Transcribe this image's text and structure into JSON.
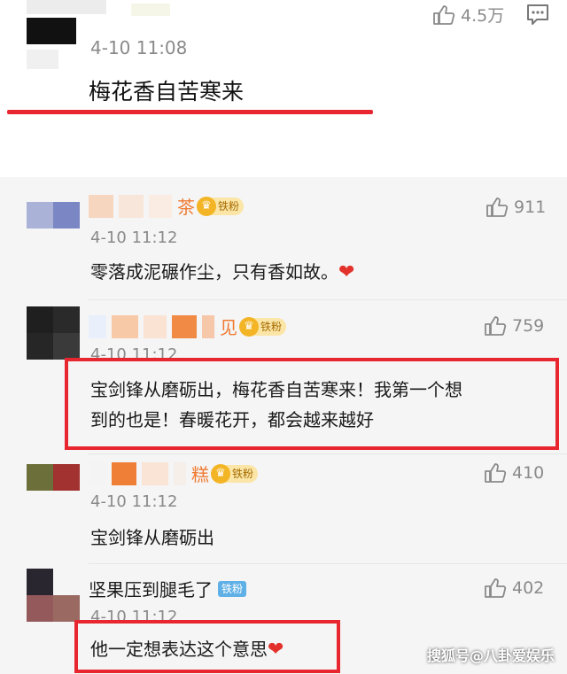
{
  "main_comment": {
    "like_count": "4.5万",
    "time": "4-10 11:08",
    "text": "梅花香自苦寒来"
  },
  "replies": [
    {
      "name_suffix": "茶",
      "badge": "铁粉",
      "like_count": "911",
      "time": "4-10 11:12",
      "text": "零落成泥碾作尘，只有香如故。"
    },
    {
      "name_suffix": "见",
      "badge": "铁粉",
      "like_count": "759",
      "time": "4-10 11:12",
      "text_line1": "宝剑锋从磨砺出，梅花香自苦寒来！我第一个想",
      "text_line2": "到的也是！春暖花开，都会越来越好"
    },
    {
      "name_suffix": "糕",
      "badge": "铁粉",
      "like_count": "410",
      "time": "4-10 11:12",
      "text": "宝剑锋从磨砺出"
    },
    {
      "name": "坚果压到腿毛了",
      "badge": "铁粉",
      "like_count": "402",
      "time": "4-10 11:12",
      "text": "他一定想表达这个意思"
    }
  ],
  "watermark": "搜狐号@八卦爱娱乐",
  "icons": {
    "like": "thumbs-up-icon",
    "reply": "comment-icon",
    "heart": "heart-icon",
    "crown": "crown-icon"
  },
  "colors": {
    "highlight_red": "#e8262f",
    "name_orange": "#ef7a32",
    "meta_gray": "#8a8a8a"
  }
}
